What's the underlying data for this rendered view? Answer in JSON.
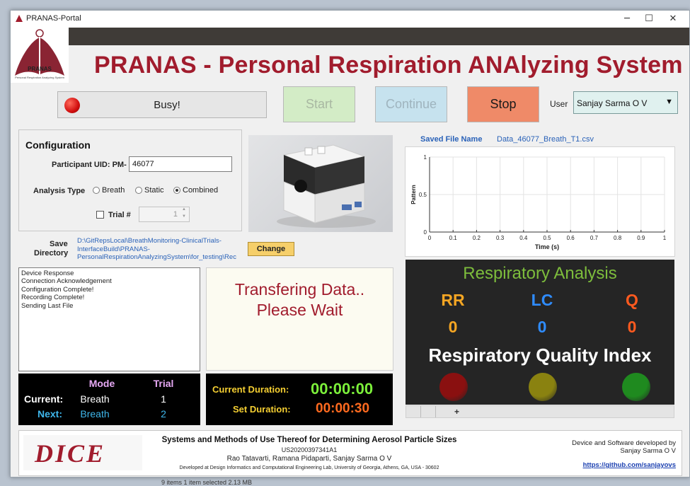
{
  "window": {
    "title": "PRANAS-Portal",
    "controls": {
      "minimize": "─",
      "maximize": "☐",
      "close": "✕"
    }
  },
  "header": {
    "logo_text": "PRANAS",
    "logo_subtext": "Personal Respiration Analyzing System",
    "title": "PRANAS - Personal Respiration ANAlyzing System"
  },
  "toolbar": {
    "status_text": "Busy!",
    "start_label": "Start",
    "continue_label": "Continue",
    "stop_label": "Stop",
    "user_label": "User",
    "user_value": "Sanjay Sarma O V",
    "user_arrow": "▼"
  },
  "configuration": {
    "title": "Configuration",
    "uid_label": "Participant UID: PM-",
    "uid_value": "46077",
    "analysis_type_label": "Analysis Type",
    "analysis_options": [
      "Breath",
      "Static",
      "Combined"
    ],
    "analysis_selected": "Combined",
    "trial_label": "Trial #",
    "trial_value": "1",
    "stepper_up": "▲",
    "stepper_down": "▼"
  },
  "save_directory": {
    "label_line1": "Save",
    "label_line2": "Directory",
    "path_lines": [
      "D:\\GitRepsLocal\\BreathMonitoring-ClinicalTrials-",
      "InterfaceBuild\\PRANAS-",
      "PersonalRespirationAnalyzingSystem\\for_testing\\Rec"
    ],
    "change_label": "Change"
  },
  "log": {
    "lines": [
      "Device Response",
      "Connection Acknowledgement",
      "Configuration Complete!",
      "Recording Complete!",
      "Sending Last File"
    ]
  },
  "message": {
    "line1": "Transfering Data..",
    "line2": "Please Wait"
  },
  "trial_table": {
    "mode_header": "Mode",
    "trial_header": "Trial",
    "current_label": "Current:",
    "current_mode": "Breath",
    "current_trial": "1",
    "next_label": "Next:",
    "next_mode": "Breath",
    "next_trial": "2"
  },
  "duration": {
    "current_label": "Current Duration:",
    "current_value": "00:00:00",
    "set_label": "Set Duration:",
    "set_value": "00:00:30"
  },
  "saved_file": {
    "label": "Saved File Name",
    "value": "Data_46077_Breath_T1.csv"
  },
  "chart_data": {
    "type": "line",
    "title": "",
    "xlabel": "Time (s)",
    "ylabel": "Pattern",
    "xlim": [
      0,
      1
    ],
    "ylim": [
      0,
      1
    ],
    "x_ticks": [
      "0",
      "0.1",
      "0.2",
      "0.3",
      "0.4",
      "0.5",
      "0.6",
      "0.7",
      "0.8",
      "0.9",
      "1"
    ],
    "y_ticks": [
      "0",
      "0.5",
      "1"
    ],
    "grid": true,
    "series": []
  },
  "respiratory_analysis": {
    "title": "Respiratory Analysis",
    "metrics": [
      {
        "name": "RR",
        "value": "0",
        "color": "#f5a623"
      },
      {
        "name": "LC",
        "value": "0",
        "color": "#2f8cff"
      },
      {
        "name": "Q",
        "value": "0",
        "color": "#ff5a1f"
      }
    ],
    "quality_title": "Respiratory Quality Index",
    "lamps": [
      {
        "name": "red",
        "color": "#8a1010"
      },
      {
        "name": "yellow",
        "color": "#8a8210"
      },
      {
        "name": "green",
        "color": "#1f8a1f"
      }
    ],
    "tab_add": "+"
  },
  "footer": {
    "logo_text": "DICE",
    "patent_title": "Systems and Methods of Use Thereof for Determining Aerosol Particle Sizes",
    "patent_number": "US20200397341A1",
    "authors": "Rao Tatavarti, Ramana Pidaparti, Sanjay Sarma O V",
    "developed_at": "Developed at Design Informatics and Computational Engineering Lab, University of Georgia, Athens, GA, USA - 30602",
    "dev_line1": "Device and Software developed by",
    "dev_line2": "Sanjay Sarma O V",
    "link": "https://github.com/sanjayovs"
  },
  "background": {
    "status_text": "9 items    1 item selected  2.13 MB"
  },
  "colors": {
    "brand_red": "#a11c2d",
    "start_bg": "#d3ecc6",
    "continue_bg": "#c6e2ee",
    "stop_bg": "#ef8a68",
    "green_time": "#7cf03a",
    "orange_time": "#ff6a1f",
    "label_gold": "#f5cf32"
  }
}
